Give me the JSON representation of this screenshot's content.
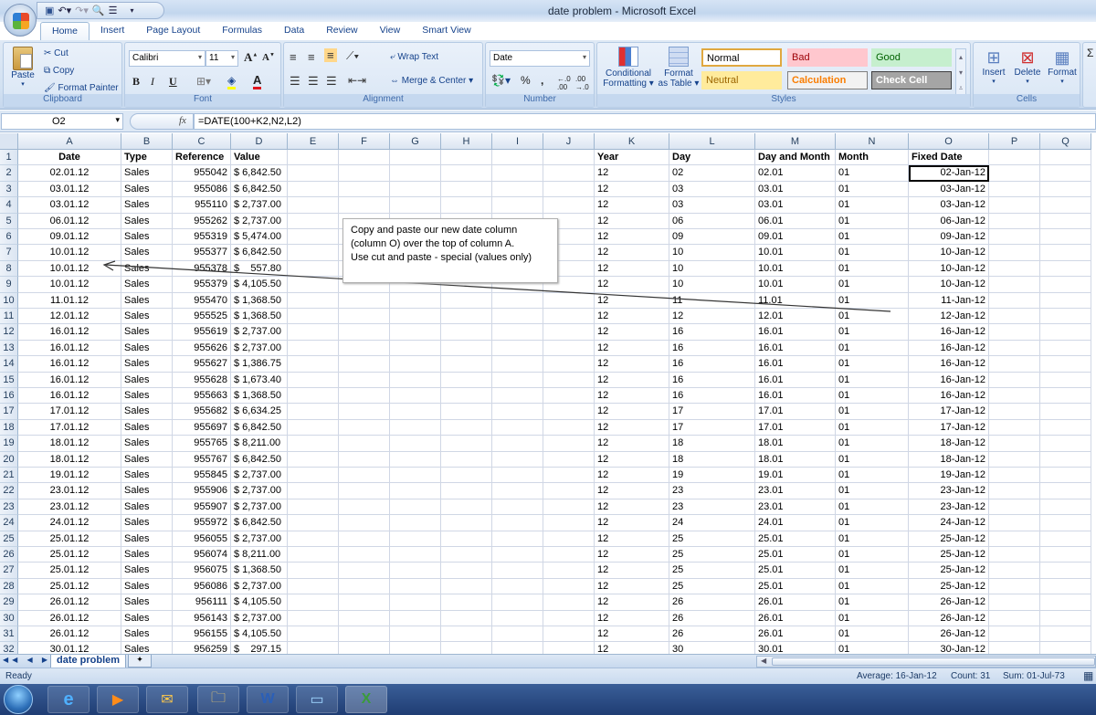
{
  "window": {
    "title": "date problem  -  Microsoft Excel"
  },
  "quick_access": {
    "icons": [
      "save-icon",
      "undo-icon",
      "redo-icon",
      "print-preview-icon",
      "align-icon",
      "customize-icon"
    ]
  },
  "ribbon_tabs": [
    "Home",
    "Insert",
    "Page Layout",
    "Formulas",
    "Data",
    "Review",
    "View",
    "Smart View"
  ],
  "active_tab": "Home",
  "clipboard": {
    "label": "Clipboard",
    "paste": "Paste",
    "cut": "Cut",
    "copy": "Copy",
    "format_painter": "Format Painter"
  },
  "font": {
    "label": "Font",
    "name": "Calibri",
    "size": "11",
    "bold": "B",
    "italic": "I",
    "underline": "U",
    "grow": "A",
    "shrink": "A"
  },
  "alignment": {
    "label": "Alignment",
    "wrap_text": "Wrap Text",
    "merge_center": "Merge & Center"
  },
  "number": {
    "label": "Number",
    "format": "Date",
    "percent": "%",
    "comma": ",",
    "inc_decimal": "+.0 .00",
    "dec_decimal": ".00 +.0"
  },
  "styles": {
    "label": "Styles",
    "conditional": "Conditional",
    "conditional2": "Formatting",
    "format_table": "Format",
    "format_table2": "as Table",
    "cells": [
      {
        "name": "Normal",
        "bg": "#ffffff",
        "color": "#000000",
        "border": "#e0a840"
      },
      {
        "name": "Bad",
        "bg": "#ffc7ce",
        "color": "#9c0006",
        "border": "#ffc7ce"
      },
      {
        "name": "Good",
        "bg": "#c6efce",
        "color": "#006100",
        "border": "#c6efce"
      },
      {
        "name": "Neutral",
        "bg": "#ffeb9c",
        "color": "#9c6500",
        "border": "#ffeb9c"
      },
      {
        "name": "Calculation",
        "bg": "#f2f2f2",
        "color": "#fa7d00",
        "border": "#7f7f7f"
      },
      {
        "name": "Check Cell",
        "bg": "#a5a5a5",
        "color": "#ffffff",
        "border": "#3f3f3f"
      }
    ]
  },
  "cells_group": {
    "label": "Cells",
    "insert": "Insert",
    "delete": "Delete",
    "format": "Format"
  },
  "name_box": "O2",
  "formula": "=DATE(100+K2,N2,L2)",
  "columns": [
    "A",
    "B",
    "C",
    "D",
    "E",
    "F",
    "G",
    "H",
    "I",
    "J",
    "K",
    "L",
    "M",
    "N",
    "O",
    "P",
    "Q"
  ],
  "headers": {
    "A": "Date",
    "B": "Type",
    "C": "Reference",
    "D": "Value",
    "K": "Year",
    "L": "Day",
    "M": "Day and Month",
    "N": "Month",
    "O": "Fixed Date"
  },
  "rows": [
    {
      "n": "2",
      "A": "02.01.12",
      "B": "Sales",
      "C": "955042",
      "D": "$ 6,842.50",
      "K": "12",
      "L": "02",
      "M": "02.01",
      "N": "01",
      "O": "02-Jan-12"
    },
    {
      "n": "3",
      "A": "03.01.12",
      "B": "Sales",
      "C": "955086",
      "D": "$ 6,842.50",
      "K": "12",
      "L": "03",
      "M": "03.01",
      "N": "01",
      "O": "03-Jan-12"
    },
    {
      "n": "4",
      "A": "03.01.12",
      "B": "Sales",
      "C": "955110",
      "D": "$ 2,737.00",
      "K": "12",
      "L": "03",
      "M": "03.01",
      "N": "01",
      "O": "03-Jan-12"
    },
    {
      "n": "5",
      "A": "06.01.12",
      "B": "Sales",
      "C": "955262",
      "D": "$ 2,737.00",
      "K": "12",
      "L": "06",
      "M": "06.01",
      "N": "01",
      "O": "06-Jan-12"
    },
    {
      "n": "6",
      "A": "09.01.12",
      "B": "Sales",
      "C": "955319",
      "D": "$ 5,474.00",
      "K": "12",
      "L": "09",
      "M": "09.01",
      "N": "01",
      "O": "09-Jan-12"
    },
    {
      "n": "7",
      "A": "10.01.12",
      "B": "Sales",
      "C": "955377",
      "D": "$ 6,842.50",
      "K": "12",
      "L": "10",
      "M": "10.01",
      "N": "01",
      "O": "10-Jan-12"
    },
    {
      "n": "8",
      "A": "10.01.12",
      "B": "Sales",
      "C": "955378",
      "D": "$    557.80",
      "K": "12",
      "L": "10",
      "M": "10.01",
      "N": "01",
      "O": "10-Jan-12"
    },
    {
      "n": "9",
      "A": "10.01.12",
      "B": "Sales",
      "C": "955379",
      "D": "$ 4,105.50",
      "K": "12",
      "L": "10",
      "M": "10.01",
      "N": "01",
      "O": "10-Jan-12"
    },
    {
      "n": "10",
      "A": "11.01.12",
      "B": "Sales",
      "C": "955470",
      "D": "$ 1,368.50",
      "K": "12",
      "L": "11",
      "M": "11.01",
      "N": "01",
      "O": "11-Jan-12"
    },
    {
      "n": "11",
      "A": "12.01.12",
      "B": "Sales",
      "C": "955525",
      "D": "$ 1,368.50",
      "K": "12",
      "L": "12",
      "M": "12.01",
      "N": "01",
      "O": "12-Jan-12"
    },
    {
      "n": "12",
      "A": "16.01.12",
      "B": "Sales",
      "C": "955619",
      "D": "$ 2,737.00",
      "K": "12",
      "L": "16",
      "M": "16.01",
      "N": "01",
      "O": "16-Jan-12"
    },
    {
      "n": "13",
      "A": "16.01.12",
      "B": "Sales",
      "C": "955626",
      "D": "$ 2,737.00",
      "K": "12",
      "L": "16",
      "M": "16.01",
      "N": "01",
      "O": "16-Jan-12"
    },
    {
      "n": "14",
      "A": "16.01.12",
      "B": "Sales",
      "C": "955627",
      "D": "$ 1,386.75",
      "K": "12",
      "L": "16",
      "M": "16.01",
      "N": "01",
      "O": "16-Jan-12"
    },
    {
      "n": "15",
      "A": "16.01.12",
      "B": "Sales",
      "C": "955628",
      "D": "$ 1,673.40",
      "K": "12",
      "L": "16",
      "M": "16.01",
      "N": "01",
      "O": "16-Jan-12"
    },
    {
      "n": "16",
      "A": "16.01.12",
      "B": "Sales",
      "C": "955663",
      "D": "$ 1,368.50",
      "K": "12",
      "L": "16",
      "M": "16.01",
      "N": "01",
      "O": "16-Jan-12"
    },
    {
      "n": "17",
      "A": "17.01.12",
      "B": "Sales",
      "C": "955682",
      "D": "$ 6,634.25",
      "K": "12",
      "L": "17",
      "M": "17.01",
      "N": "01",
      "O": "17-Jan-12"
    },
    {
      "n": "18",
      "A": "17.01.12",
      "B": "Sales",
      "C": "955697",
      "D": "$ 6,842.50",
      "K": "12",
      "L": "17",
      "M": "17.01",
      "N": "01",
      "O": "17-Jan-12"
    },
    {
      "n": "19",
      "A": "18.01.12",
      "B": "Sales",
      "C": "955765",
      "D": "$ 8,211.00",
      "K": "12",
      "L": "18",
      "M": "18.01",
      "N": "01",
      "O": "18-Jan-12"
    },
    {
      "n": "20",
      "A": "18.01.12",
      "B": "Sales",
      "C": "955767",
      "D": "$ 6,842.50",
      "K": "12",
      "L": "18",
      "M": "18.01",
      "N": "01",
      "O": "18-Jan-12"
    },
    {
      "n": "21",
      "A": "19.01.12",
      "B": "Sales",
      "C": "955845",
      "D": "$ 2,737.00",
      "K": "12",
      "L": "19",
      "M": "19.01",
      "N": "01",
      "O": "19-Jan-12"
    },
    {
      "n": "22",
      "A": "23.01.12",
      "B": "Sales",
      "C": "955906",
      "D": "$ 2,737.00",
      "K": "12",
      "L": "23",
      "M": "23.01",
      "N": "01",
      "O": "23-Jan-12"
    },
    {
      "n": "23",
      "A": "23.01.12",
      "B": "Sales",
      "C": "955907",
      "D": "$ 2,737.00",
      "K": "12",
      "L": "23",
      "M": "23.01",
      "N": "01",
      "O": "23-Jan-12"
    },
    {
      "n": "24",
      "A": "24.01.12",
      "B": "Sales",
      "C": "955972",
      "D": "$ 6,842.50",
      "K": "12",
      "L": "24",
      "M": "24.01",
      "N": "01",
      "O": "24-Jan-12"
    },
    {
      "n": "25",
      "A": "25.01.12",
      "B": "Sales",
      "C": "956055",
      "D": "$ 2,737.00",
      "K": "12",
      "L": "25",
      "M": "25.01",
      "N": "01",
      "O": "25-Jan-12"
    },
    {
      "n": "26",
      "A": "25.01.12",
      "B": "Sales",
      "C": "956074",
      "D": "$ 8,211.00",
      "K": "12",
      "L": "25",
      "M": "25.01",
      "N": "01",
      "O": "25-Jan-12"
    },
    {
      "n": "27",
      "A": "25.01.12",
      "B": "Sales",
      "C": "956075",
      "D": "$ 1,368.50",
      "K": "12",
      "L": "25",
      "M": "25.01",
      "N": "01",
      "O": "25-Jan-12"
    },
    {
      "n": "28",
      "A": "25.01.12",
      "B": "Sales",
      "C": "956086",
      "D": "$ 2,737.00",
      "K": "12",
      "L": "25",
      "M": "25.01",
      "N": "01",
      "O": "25-Jan-12"
    },
    {
      "n": "29",
      "A": "26.01.12",
      "B": "Sales",
      "C": "956111",
      "D": "$ 4,105.50",
      "K": "12",
      "L": "26",
      "M": "26.01",
      "N": "01",
      "O": "26-Jan-12"
    },
    {
      "n": "30",
      "A": "26.01.12",
      "B": "Sales",
      "C": "956143",
      "D": "$ 2,737.00",
      "K": "12",
      "L": "26",
      "M": "26.01",
      "N": "01",
      "O": "26-Jan-12"
    },
    {
      "n": "31",
      "A": "26.01.12",
      "B": "Sales",
      "C": "956155",
      "D": "$ 4,105.50",
      "K": "12",
      "L": "26",
      "M": "26.01",
      "N": "01",
      "O": "26-Jan-12"
    },
    {
      "n": "32",
      "A": "30.01.12",
      "B": "Sales",
      "C": "956259",
      "D": "$    297.15",
      "K": "12",
      "L": "30",
      "M": "30.01",
      "N": "01",
      "O": "30-Jan-12"
    }
  ],
  "textbox": {
    "line1": "Copy and paste our new date column",
    "line2": "(column O) over the top of column A.",
    "line3": "Use cut and paste - special (values only)"
  },
  "sheet_tab": "date problem",
  "status": {
    "ready": "Ready",
    "average": "Average: 16-Jan-12",
    "count": "Count: 31",
    "sum": "Sum: 01-Jul-73"
  },
  "taskbar": {
    "items": [
      "internet-explorer-icon",
      "media-player-icon",
      "outlook-icon",
      "explorer-icon",
      "word-icon",
      "picture-icon",
      "excel-icon"
    ]
  }
}
